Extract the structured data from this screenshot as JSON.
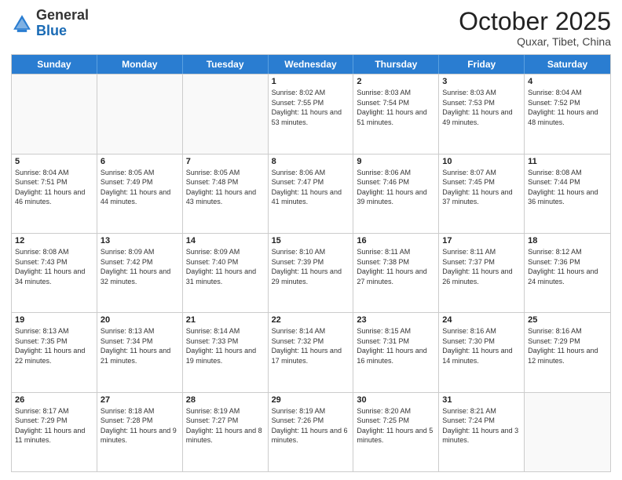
{
  "header": {
    "logo_general": "General",
    "logo_blue": "Blue",
    "month_title": "October 2025",
    "location": "Quxar, Tibet, China"
  },
  "days_of_week": [
    "Sunday",
    "Monday",
    "Tuesday",
    "Wednesday",
    "Thursday",
    "Friday",
    "Saturday"
  ],
  "weeks": [
    [
      {
        "day": "",
        "info": ""
      },
      {
        "day": "",
        "info": ""
      },
      {
        "day": "",
        "info": ""
      },
      {
        "day": "1",
        "info": "Sunrise: 8:02 AM\nSunset: 7:55 PM\nDaylight: 11 hours\nand 53 minutes."
      },
      {
        "day": "2",
        "info": "Sunrise: 8:03 AM\nSunset: 7:54 PM\nDaylight: 11 hours\nand 51 minutes."
      },
      {
        "day": "3",
        "info": "Sunrise: 8:03 AM\nSunset: 7:53 PM\nDaylight: 11 hours\nand 49 minutes."
      },
      {
        "day": "4",
        "info": "Sunrise: 8:04 AM\nSunset: 7:52 PM\nDaylight: 11 hours\nand 48 minutes."
      }
    ],
    [
      {
        "day": "5",
        "info": "Sunrise: 8:04 AM\nSunset: 7:51 PM\nDaylight: 11 hours\nand 46 minutes."
      },
      {
        "day": "6",
        "info": "Sunrise: 8:05 AM\nSunset: 7:49 PM\nDaylight: 11 hours\nand 44 minutes."
      },
      {
        "day": "7",
        "info": "Sunrise: 8:05 AM\nSunset: 7:48 PM\nDaylight: 11 hours\nand 43 minutes."
      },
      {
        "day": "8",
        "info": "Sunrise: 8:06 AM\nSunset: 7:47 PM\nDaylight: 11 hours\nand 41 minutes."
      },
      {
        "day": "9",
        "info": "Sunrise: 8:06 AM\nSunset: 7:46 PM\nDaylight: 11 hours\nand 39 minutes."
      },
      {
        "day": "10",
        "info": "Sunrise: 8:07 AM\nSunset: 7:45 PM\nDaylight: 11 hours\nand 37 minutes."
      },
      {
        "day": "11",
        "info": "Sunrise: 8:08 AM\nSunset: 7:44 PM\nDaylight: 11 hours\nand 36 minutes."
      }
    ],
    [
      {
        "day": "12",
        "info": "Sunrise: 8:08 AM\nSunset: 7:43 PM\nDaylight: 11 hours\nand 34 minutes."
      },
      {
        "day": "13",
        "info": "Sunrise: 8:09 AM\nSunset: 7:42 PM\nDaylight: 11 hours\nand 32 minutes."
      },
      {
        "day": "14",
        "info": "Sunrise: 8:09 AM\nSunset: 7:40 PM\nDaylight: 11 hours\nand 31 minutes."
      },
      {
        "day": "15",
        "info": "Sunrise: 8:10 AM\nSunset: 7:39 PM\nDaylight: 11 hours\nand 29 minutes."
      },
      {
        "day": "16",
        "info": "Sunrise: 8:11 AM\nSunset: 7:38 PM\nDaylight: 11 hours\nand 27 minutes."
      },
      {
        "day": "17",
        "info": "Sunrise: 8:11 AM\nSunset: 7:37 PM\nDaylight: 11 hours\nand 26 minutes."
      },
      {
        "day": "18",
        "info": "Sunrise: 8:12 AM\nSunset: 7:36 PM\nDaylight: 11 hours\nand 24 minutes."
      }
    ],
    [
      {
        "day": "19",
        "info": "Sunrise: 8:13 AM\nSunset: 7:35 PM\nDaylight: 11 hours\nand 22 minutes."
      },
      {
        "day": "20",
        "info": "Sunrise: 8:13 AM\nSunset: 7:34 PM\nDaylight: 11 hours\nand 21 minutes."
      },
      {
        "day": "21",
        "info": "Sunrise: 8:14 AM\nSunset: 7:33 PM\nDaylight: 11 hours\nand 19 minutes."
      },
      {
        "day": "22",
        "info": "Sunrise: 8:14 AM\nSunset: 7:32 PM\nDaylight: 11 hours\nand 17 minutes."
      },
      {
        "day": "23",
        "info": "Sunrise: 8:15 AM\nSunset: 7:31 PM\nDaylight: 11 hours\nand 16 minutes."
      },
      {
        "day": "24",
        "info": "Sunrise: 8:16 AM\nSunset: 7:30 PM\nDaylight: 11 hours\nand 14 minutes."
      },
      {
        "day": "25",
        "info": "Sunrise: 8:16 AM\nSunset: 7:29 PM\nDaylight: 11 hours\nand 12 minutes."
      }
    ],
    [
      {
        "day": "26",
        "info": "Sunrise: 8:17 AM\nSunset: 7:29 PM\nDaylight: 11 hours\nand 11 minutes."
      },
      {
        "day": "27",
        "info": "Sunrise: 8:18 AM\nSunset: 7:28 PM\nDaylight: 11 hours\nand 9 minutes."
      },
      {
        "day": "28",
        "info": "Sunrise: 8:19 AM\nSunset: 7:27 PM\nDaylight: 11 hours\nand 8 minutes."
      },
      {
        "day": "29",
        "info": "Sunrise: 8:19 AM\nSunset: 7:26 PM\nDaylight: 11 hours\nand 6 minutes."
      },
      {
        "day": "30",
        "info": "Sunrise: 8:20 AM\nSunset: 7:25 PM\nDaylight: 11 hours\nand 5 minutes."
      },
      {
        "day": "31",
        "info": "Sunrise: 8:21 AM\nSunset: 7:24 PM\nDaylight: 11 hours\nand 3 minutes."
      },
      {
        "day": "",
        "info": ""
      }
    ]
  ]
}
